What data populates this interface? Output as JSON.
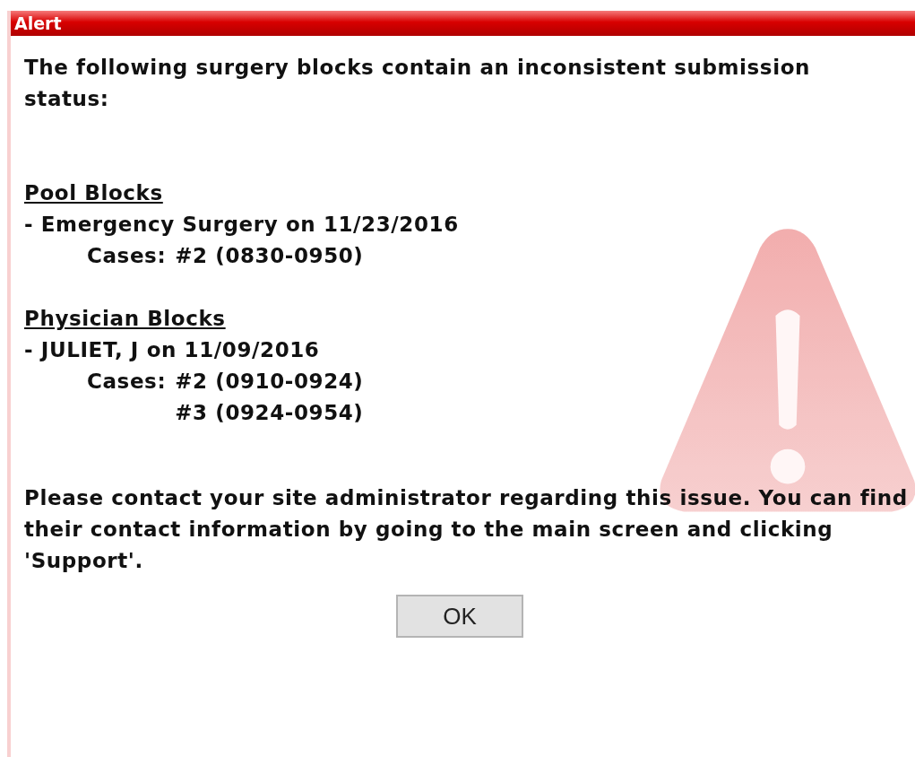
{
  "window": {
    "title": "Alert"
  },
  "message": "The following surgery blocks contain an inconsistent submission status:",
  "sections": [
    {
      "heading": "Pool Blocks",
      "entries": [
        {
          "label": "- Emergency Surgery on 11/23/2016",
          "cases_label": "Cases:",
          "cases": [
            "#2 (0830-0950)"
          ]
        }
      ]
    },
    {
      "heading": "Physician Blocks",
      "entries": [
        {
          "label": "- JULIET, J on 11/09/2016",
          "cases_label": "Cases:",
          "cases": [
            "#2 (0910-0924)",
            "#3 (0924-0954)"
          ]
        }
      ]
    }
  ],
  "footer": "Please contact your site administrator regarding this issue. You can find their contact information by going to the main screen and clicking 'Support'.",
  "buttons": [
    "OK"
  ]
}
